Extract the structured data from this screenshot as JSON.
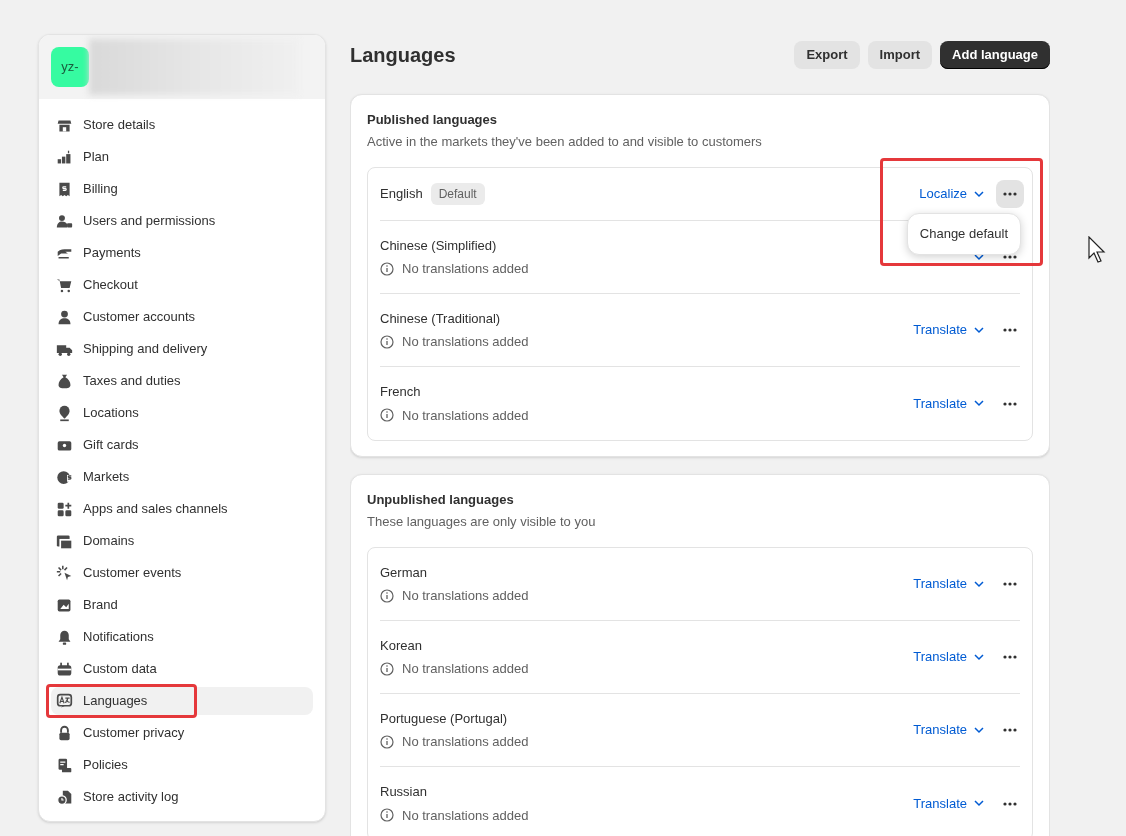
{
  "sidebar": {
    "store_badge": "yz-",
    "items": [
      {
        "label": "Store details",
        "selected": false,
        "highlighted": false
      },
      {
        "label": "Plan",
        "selected": false,
        "highlighted": false
      },
      {
        "label": "Billing",
        "selected": false,
        "highlighted": false
      },
      {
        "label": "Users and permissions",
        "selected": false,
        "highlighted": false
      },
      {
        "label": "Payments",
        "selected": false,
        "highlighted": false
      },
      {
        "label": "Checkout",
        "selected": false,
        "highlighted": false
      },
      {
        "label": "Customer accounts",
        "selected": false,
        "highlighted": false
      },
      {
        "label": "Shipping and delivery",
        "selected": false,
        "highlighted": false
      },
      {
        "label": "Taxes and duties",
        "selected": false,
        "highlighted": false
      },
      {
        "label": "Locations",
        "selected": false,
        "highlighted": false
      },
      {
        "label": "Gift cards",
        "selected": false,
        "highlighted": false
      },
      {
        "label": "Markets",
        "selected": false,
        "highlighted": false
      },
      {
        "label": "Apps and sales channels",
        "selected": false,
        "highlighted": false
      },
      {
        "label": "Domains",
        "selected": false,
        "highlighted": false
      },
      {
        "label": "Customer events",
        "selected": false,
        "highlighted": false
      },
      {
        "label": "Brand",
        "selected": false,
        "highlighted": false
      },
      {
        "label": "Notifications",
        "selected": false,
        "highlighted": false
      },
      {
        "label": "Custom data",
        "selected": false,
        "highlighted": false
      },
      {
        "label": "Languages",
        "selected": true,
        "highlighted": true
      },
      {
        "label": "Customer privacy",
        "selected": false,
        "highlighted": false
      },
      {
        "label": "Policies",
        "selected": false,
        "highlighted": false
      },
      {
        "label": "Store activity log",
        "selected": false,
        "highlighted": false
      }
    ]
  },
  "header": {
    "title": "Languages",
    "buttons": [
      {
        "label": "Export",
        "kind": "secondary"
      },
      {
        "label": "Import",
        "kind": "secondary"
      },
      {
        "label": "Add language",
        "kind": "primary"
      }
    ]
  },
  "sections": [
    {
      "title": "Published languages",
      "subtitle": "Active in the markets they've been added to and visible to customers",
      "languages": [
        {
          "name": "English",
          "badge": "Default",
          "action": "Localize",
          "menu_open": true,
          "highlighted": true,
          "menu": [
            "Change default"
          ]
        },
        {
          "name": "Chinese (Simplified)",
          "status": "No translations added",
          "menu_open": false
        },
        {
          "name": "Chinese (Traditional)",
          "status": "No translations added",
          "action": "Translate",
          "menu_open": false
        },
        {
          "name": "French",
          "status": "No translations added",
          "action": "Translate",
          "menu_open": false
        }
      ]
    },
    {
      "title": "Unpublished languages",
      "subtitle": "These languages are only visible to you",
      "languages": [
        {
          "name": "German",
          "status": "No translations added",
          "action": "Translate",
          "menu_open": false
        },
        {
          "name": "Korean",
          "status": "No translations added",
          "action": "Translate",
          "menu_open": false
        },
        {
          "name": "Portuguese (Portugal)",
          "status": "No translations added",
          "action": "Translate",
          "menu_open": false
        },
        {
          "name": "Russian",
          "status": "No translations added",
          "action": "Translate",
          "menu_open": false
        }
      ]
    }
  ]
}
